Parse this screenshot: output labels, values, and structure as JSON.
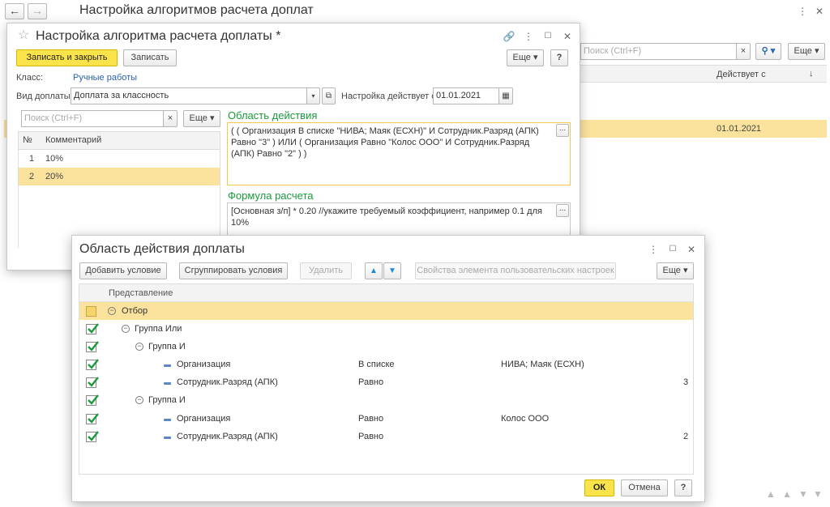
{
  "main": {
    "title": "Настройка алгоритмов расчета доплат",
    "search_placeholder": "Поиск (Ctrl+F)",
    "more_label": "Еще",
    "col_effective": "Действует с",
    "row_date": "01.01.2021",
    "sort_icon": "↓"
  },
  "dialog1": {
    "title": "Настройка алгоритма расчета доплаты *",
    "save_close_label": "Записать и закрыть",
    "save_label": "Записать",
    "more_label": "Еще",
    "help_label": "?",
    "class_label": "Класс:",
    "class_value": "Ручные работы",
    "type_label": "Вид доплаты:",
    "type_value": "Доплата за классность",
    "effective_label": "Настройка действует с:",
    "effective_value": "01.01.2021",
    "search_placeholder": "Поиск (Ctrl+F)",
    "col_num": "№",
    "col_comment": "Комментарий",
    "rows": [
      {
        "n": "1",
        "c": "10%"
      },
      {
        "n": "2",
        "c": "20%"
      }
    ],
    "scope_title": "Область действия",
    "scope_text": "( ( Организация В списке \"НИВА; Маяк (ЕСХН)\" И Сотрудник.Разряд (АПК) Равно \"3\" ) ИЛИ ( Организация Равно \"Колос ООО\" И Сотрудник.Разряд (АПК) Равно \"2\" ) )",
    "formula_title": "Формула расчета",
    "formula_text": "[Основная з/п] * 0.20 //укажите требуемый коэффициент, например 0.1 для 10%",
    "dots": "..."
  },
  "dialog2": {
    "title": "Область действия доплаты",
    "add_label": "Добавить условие",
    "group_label": "Сгруппировать условия",
    "delete_label": "Удалить",
    "props_label": "Свойства элемента пользовательских настроек",
    "more_label": "Еще",
    "col_repr": "Представление",
    "tree": [
      {
        "name": "Отбор",
        "cond": "",
        "val": "",
        "num": ""
      },
      {
        "name": "Группа Или",
        "cond": "",
        "val": "",
        "num": ""
      },
      {
        "name": "Группа И",
        "cond": "",
        "val": "",
        "num": ""
      },
      {
        "name": "Организация",
        "cond": "В списке",
        "val": "НИВА; Маяк (ЕСХН)",
        "num": ""
      },
      {
        "name": "Сотрудник.Разряд (АПК)",
        "cond": "Равно",
        "val": "",
        "num": "3"
      },
      {
        "name": "Группа И",
        "cond": "",
        "val": "",
        "num": ""
      },
      {
        "name": "Организация",
        "cond": "Равно",
        "val": "Колос ООО",
        "num": ""
      },
      {
        "name": "Сотрудник.Разряд (АПК)",
        "cond": "Равно",
        "val": "",
        "num": "2"
      }
    ],
    "ok_label": "ОК",
    "cancel_label": "Отмена",
    "help_label": "?"
  },
  "colors": {
    "accent_yellow": "#fbe44b",
    "row_highlight": "#fbe29d",
    "green_title": "#1b9a3c",
    "link_blue": "#2a5fb0"
  }
}
